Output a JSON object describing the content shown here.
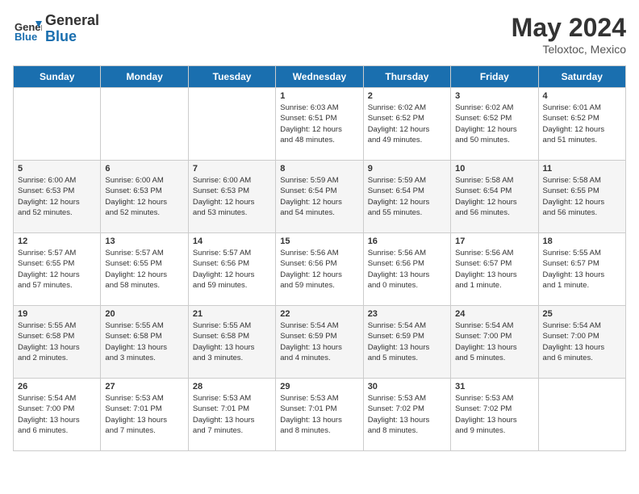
{
  "header": {
    "logo_line1": "General",
    "logo_line2": "Blue",
    "month_year": "May 2024",
    "location": "Teloxtoc, Mexico"
  },
  "days_of_week": [
    "Sunday",
    "Monday",
    "Tuesday",
    "Wednesday",
    "Thursday",
    "Friday",
    "Saturday"
  ],
  "weeks": [
    [
      {
        "day": "",
        "detail": ""
      },
      {
        "day": "",
        "detail": ""
      },
      {
        "day": "",
        "detail": ""
      },
      {
        "day": "1",
        "detail": "Sunrise: 6:03 AM\nSunset: 6:51 PM\nDaylight: 12 hours\nand 48 minutes."
      },
      {
        "day": "2",
        "detail": "Sunrise: 6:02 AM\nSunset: 6:52 PM\nDaylight: 12 hours\nand 49 minutes."
      },
      {
        "day": "3",
        "detail": "Sunrise: 6:02 AM\nSunset: 6:52 PM\nDaylight: 12 hours\nand 50 minutes."
      },
      {
        "day": "4",
        "detail": "Sunrise: 6:01 AM\nSunset: 6:52 PM\nDaylight: 12 hours\nand 51 minutes."
      }
    ],
    [
      {
        "day": "5",
        "detail": "Sunrise: 6:00 AM\nSunset: 6:53 PM\nDaylight: 12 hours\nand 52 minutes."
      },
      {
        "day": "6",
        "detail": "Sunrise: 6:00 AM\nSunset: 6:53 PM\nDaylight: 12 hours\nand 52 minutes."
      },
      {
        "day": "7",
        "detail": "Sunrise: 6:00 AM\nSunset: 6:53 PM\nDaylight: 12 hours\nand 53 minutes."
      },
      {
        "day": "8",
        "detail": "Sunrise: 5:59 AM\nSunset: 6:54 PM\nDaylight: 12 hours\nand 54 minutes."
      },
      {
        "day": "9",
        "detail": "Sunrise: 5:59 AM\nSunset: 6:54 PM\nDaylight: 12 hours\nand 55 minutes."
      },
      {
        "day": "10",
        "detail": "Sunrise: 5:58 AM\nSunset: 6:54 PM\nDaylight: 12 hours\nand 56 minutes."
      },
      {
        "day": "11",
        "detail": "Sunrise: 5:58 AM\nSunset: 6:55 PM\nDaylight: 12 hours\nand 56 minutes."
      }
    ],
    [
      {
        "day": "12",
        "detail": "Sunrise: 5:57 AM\nSunset: 6:55 PM\nDaylight: 12 hours\nand 57 minutes."
      },
      {
        "day": "13",
        "detail": "Sunrise: 5:57 AM\nSunset: 6:55 PM\nDaylight: 12 hours\nand 58 minutes."
      },
      {
        "day": "14",
        "detail": "Sunrise: 5:57 AM\nSunset: 6:56 PM\nDaylight: 12 hours\nand 59 minutes."
      },
      {
        "day": "15",
        "detail": "Sunrise: 5:56 AM\nSunset: 6:56 PM\nDaylight: 12 hours\nand 59 minutes."
      },
      {
        "day": "16",
        "detail": "Sunrise: 5:56 AM\nSunset: 6:56 PM\nDaylight: 13 hours\nand 0 minutes."
      },
      {
        "day": "17",
        "detail": "Sunrise: 5:56 AM\nSunset: 6:57 PM\nDaylight: 13 hours\nand 1 minute."
      },
      {
        "day": "18",
        "detail": "Sunrise: 5:55 AM\nSunset: 6:57 PM\nDaylight: 13 hours\nand 1 minute."
      }
    ],
    [
      {
        "day": "19",
        "detail": "Sunrise: 5:55 AM\nSunset: 6:58 PM\nDaylight: 13 hours\nand 2 minutes."
      },
      {
        "day": "20",
        "detail": "Sunrise: 5:55 AM\nSunset: 6:58 PM\nDaylight: 13 hours\nand 3 minutes."
      },
      {
        "day": "21",
        "detail": "Sunrise: 5:55 AM\nSunset: 6:58 PM\nDaylight: 13 hours\nand 3 minutes."
      },
      {
        "day": "22",
        "detail": "Sunrise: 5:54 AM\nSunset: 6:59 PM\nDaylight: 13 hours\nand 4 minutes."
      },
      {
        "day": "23",
        "detail": "Sunrise: 5:54 AM\nSunset: 6:59 PM\nDaylight: 13 hours\nand 5 minutes."
      },
      {
        "day": "24",
        "detail": "Sunrise: 5:54 AM\nSunset: 7:00 PM\nDaylight: 13 hours\nand 5 minutes."
      },
      {
        "day": "25",
        "detail": "Sunrise: 5:54 AM\nSunset: 7:00 PM\nDaylight: 13 hours\nand 6 minutes."
      }
    ],
    [
      {
        "day": "26",
        "detail": "Sunrise: 5:54 AM\nSunset: 7:00 PM\nDaylight: 13 hours\nand 6 minutes."
      },
      {
        "day": "27",
        "detail": "Sunrise: 5:53 AM\nSunset: 7:01 PM\nDaylight: 13 hours\nand 7 minutes."
      },
      {
        "day": "28",
        "detail": "Sunrise: 5:53 AM\nSunset: 7:01 PM\nDaylight: 13 hours\nand 7 minutes."
      },
      {
        "day": "29",
        "detail": "Sunrise: 5:53 AM\nSunset: 7:01 PM\nDaylight: 13 hours\nand 8 minutes."
      },
      {
        "day": "30",
        "detail": "Sunrise: 5:53 AM\nSunset: 7:02 PM\nDaylight: 13 hours\nand 8 minutes."
      },
      {
        "day": "31",
        "detail": "Sunrise: 5:53 AM\nSunset: 7:02 PM\nDaylight: 13 hours\nand 9 minutes."
      },
      {
        "day": "",
        "detail": ""
      }
    ]
  ]
}
